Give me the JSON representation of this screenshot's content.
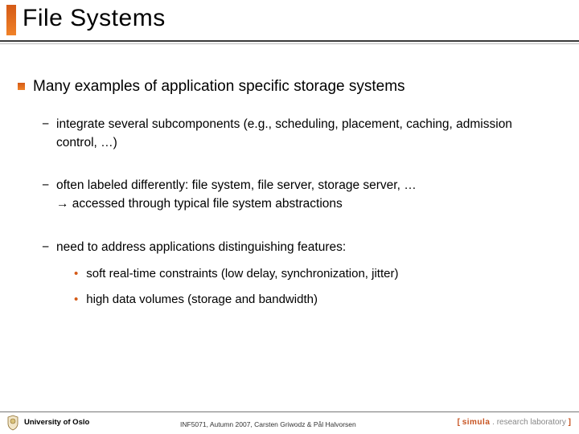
{
  "title": "File Systems",
  "bullet": "Many examples of application specific storage systems",
  "sub": {
    "a": "integrate several subcomponents (e.g., scheduling, placement, caching, admission control, …)",
    "b1": "often labeled differently: file system, file server, storage server, …",
    "b2": "→ accessed through typical file system abstractions",
    "c": "need to address applications distinguishing features:",
    "c_items": {
      "x": "soft real-time constraints (low delay, synchronization, jitter)",
      "y": "high data volumes (storage and bandwidth)"
    }
  },
  "footer": {
    "university": "University of Oslo",
    "course": "INF5071, Autumn 2007, Carsten Griwodz & Pål Halvorsen",
    "lab_open": "[ ",
    "lab_name": "simula",
    "lab_rest": " . research laboratory ",
    "lab_close": "]"
  }
}
